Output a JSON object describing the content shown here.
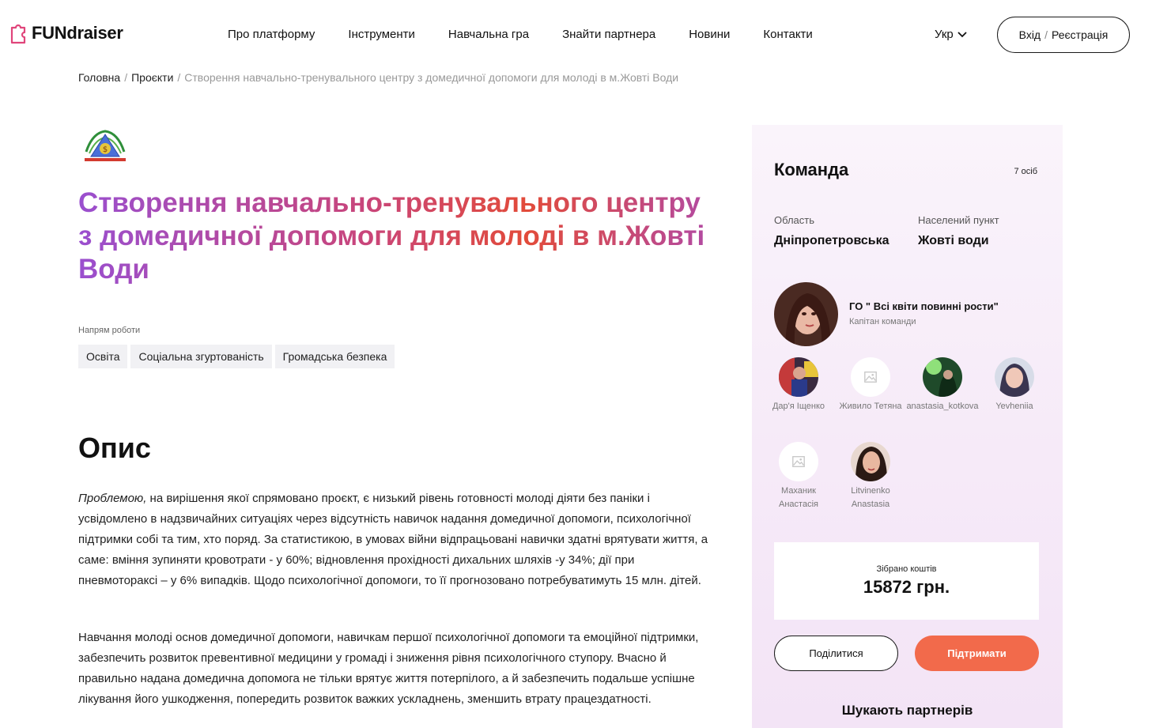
{
  "header": {
    "logo_text": "FUNdraiser",
    "nav": [
      "Про платформу",
      "Інструменти",
      "Навчальна гра",
      "Знайти партнера",
      "Новини",
      "Контакти"
    ],
    "language": "Укр",
    "login_label": "Вхід",
    "register_label": "Реєстрація"
  },
  "breadcrumb": {
    "home": "Головна",
    "projects": "Проєкти",
    "current": "Створення навчально-тренувального центру з домедичної допомоги для молоді в м.Жовті Води"
  },
  "project": {
    "title": "Створення навчально-тренувального центру з домедичної допомоги для молоді в м.Жовті Води",
    "direction_label": "Напрям роботи",
    "tags": [
      "Освіта",
      "Соціальна згуртованість",
      "Громадська безпека"
    ]
  },
  "description": {
    "title": "Опис",
    "para1_lead": "Проблемою,",
    "para1_rest": " на вирішення якої спрямовано проєкт, є низький рівень готовності молоді діяти без паніки і усвідомлено  в надзвичайних ситуаціях через відсутність навичок надання домедичної допомоги, психологічної підтримки собі та тим, хто поряд. За статистикою, в умовах війни відпрацьовані навички здатні врятувати життя, а саме: вміння зупиняти кровотрати -  у 60%; відновлення прохідності дихальних шляхів -у 34%;  дії при пневмотораксі – у  6% випадків. Щодо психологічної допомоги, то її прогнозовано потребуватимуть 15 млн. дітей.",
    "para2": "   Навчання молоді основ домедичної допомоги, навичкам першої психологічної допомоги та емоційної підтримки, забезпечить розвиток превентивної  медицини у громаді  і зниження рівня психологічного ступору.  Вчасно й правильно надана домедична допомога  не тільки врятує життя потерпілого, а й забезпечить подальше успішне лікування його  ушкодження, попередить розвиток важких ускладнень, зменшить втрату працездатності."
  },
  "team": {
    "title": "Команда",
    "count": "7 осіб",
    "region_label": "Область",
    "region_value": "Дніпропетровська",
    "city_label": "Населений пункт",
    "city_value": "Жовті води",
    "captain_name": "ГО \" Всі квіти повинні рости\"",
    "captain_role": "Капітан команди",
    "members": [
      {
        "name": "Дар'я Іщенко"
      },
      {
        "name": "Живило Тетяна"
      },
      {
        "name": "anastasia_kotkova"
      },
      {
        "name": "Yevheniia"
      },
      {
        "name": "Маханик Анастасія"
      },
      {
        "name": "Litvinenko Anastasia"
      }
    ]
  },
  "funds": {
    "label": "Зібрано коштів",
    "value": "15872 грн."
  },
  "actions": {
    "share": "Поділитися",
    "support": "Підтримати"
  },
  "partners_title": "Шукають партнерів",
  "colors": {
    "accent": "#f26a4b",
    "title_gradient_start": "#9a4fcf",
    "title_gradient_end": "#e24b3a",
    "card_bg": "#f6eaf8"
  }
}
